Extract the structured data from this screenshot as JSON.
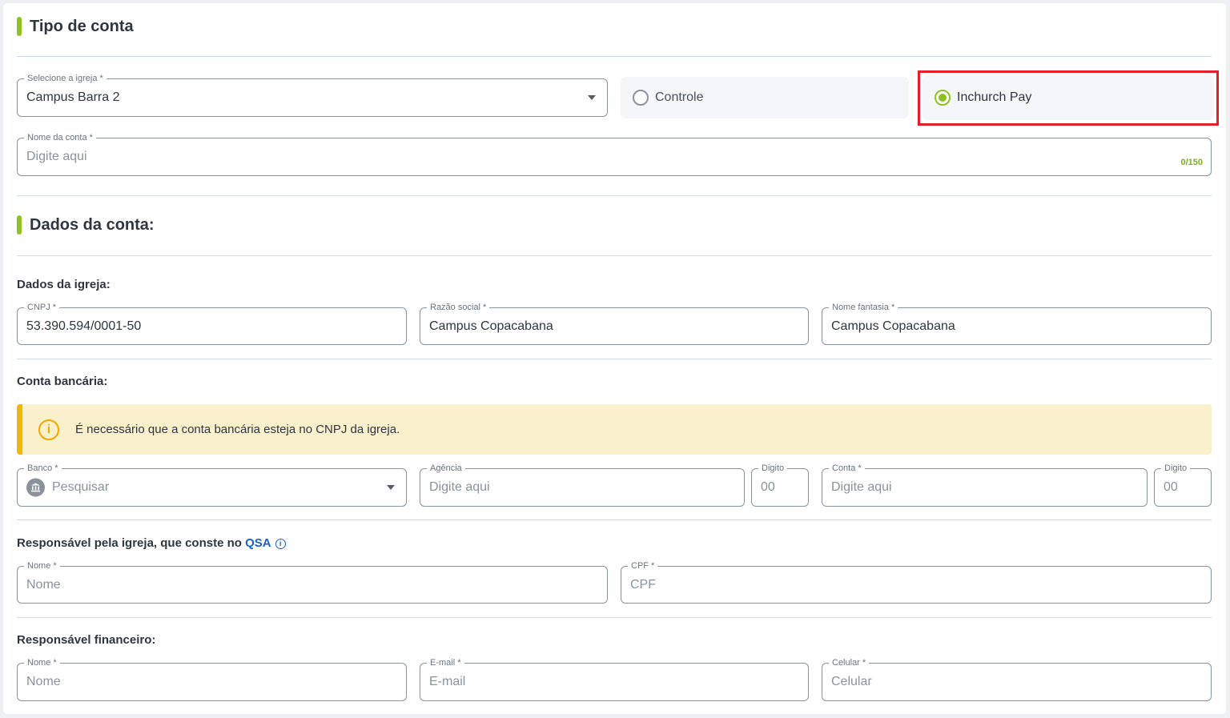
{
  "tipo_de_conta": {
    "title": "Tipo de conta",
    "igreja": {
      "label": "Selecione a igreja *",
      "value": "Campus Barra 2"
    },
    "options": [
      {
        "label": "Controle",
        "selected": false
      },
      {
        "label": "Inchurch Pay",
        "selected": true
      }
    ],
    "nome_conta": {
      "label": "Nome da conta *",
      "placeholder": "Digite aqui",
      "counter": "0/150"
    }
  },
  "dados_da_conta": {
    "title": "Dados da conta:",
    "dados_igreja": {
      "title": "Dados da igreja:",
      "cnpj": {
        "label": "CNPJ *",
        "value": "53.390.594/0001-50"
      },
      "razao_social": {
        "label": "Razão social *",
        "value": "Campus Copacabana"
      },
      "nome_fantasia": {
        "label": "Nome fantasia *",
        "value": "Campus Copacabana"
      }
    },
    "conta_bancaria": {
      "title": "Conta bancária:",
      "alert": "É necessário que a conta bancária esteja no CNPJ da igreja.",
      "banco": {
        "label": "Banco *",
        "placeholder": "Pesquisar"
      },
      "agencia": {
        "label": "Agência",
        "placeholder": "Digite aqui"
      },
      "agencia_digito": {
        "label": "Digito",
        "placeholder": "00"
      },
      "conta": {
        "label": "Conta *",
        "placeholder": "Digite aqui"
      },
      "conta_digito": {
        "label": "Digito",
        "placeholder": "00"
      }
    },
    "responsavel_igreja": {
      "title_prefix": "Responsável pela igreja, que conste no ",
      "title_link": "QSA",
      "nome": {
        "label": "Nome *",
        "placeholder": "Nome"
      },
      "cpf": {
        "label": "CPF *",
        "placeholder": "CPF"
      }
    },
    "responsavel_financeiro": {
      "title": "Responsável financeiro:",
      "nome": {
        "label": "Nome *",
        "placeholder": "Nome"
      },
      "email": {
        "label": "E-mail *",
        "placeholder": "E-mail"
      },
      "celular": {
        "label": "Celular *",
        "placeholder": "Celular"
      }
    }
  },
  "colors": {
    "accent": "#8dc21f",
    "highlight": "#e3202a",
    "alert_bg": "#faf0cb",
    "alert_border": "#f2b705",
    "link": "#1a5fd0"
  },
  "icons": {
    "dropdown": "chevron-down-icon",
    "alert": "info-icon",
    "bank": "bank-icon",
    "qsa_info": "info-icon"
  }
}
